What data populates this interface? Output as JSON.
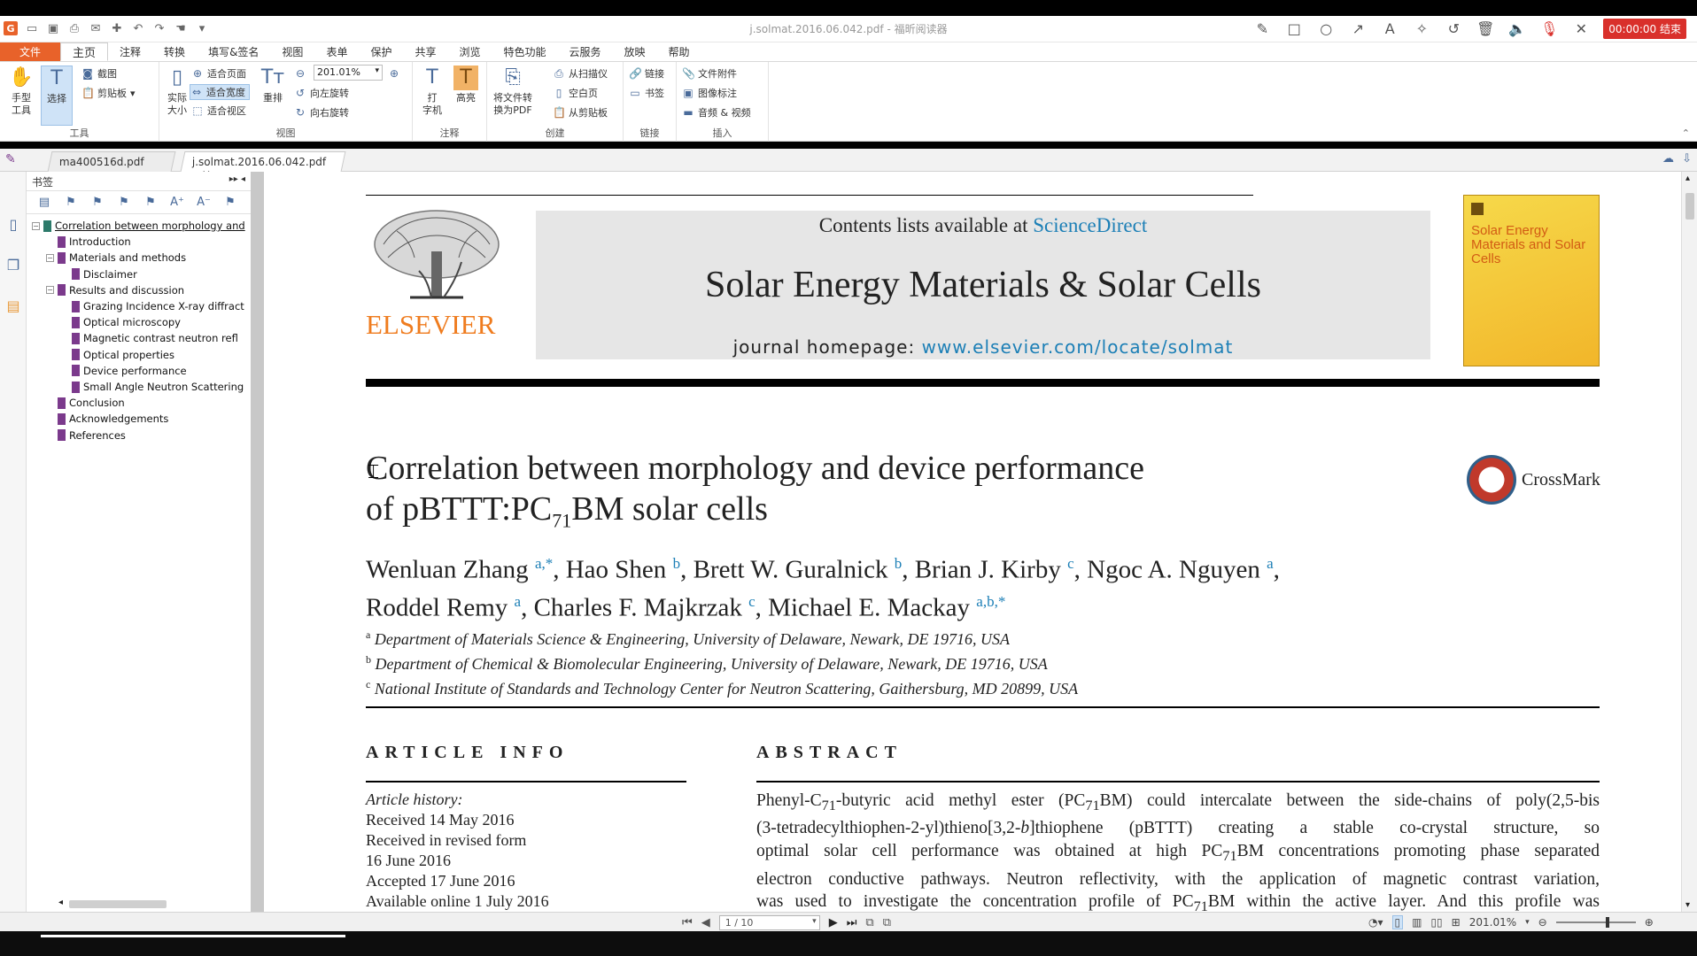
{
  "window": {
    "title": "j.solmat.2016.06.042.pdf - 福昕阅读器",
    "record_label": "00:00:00 结束"
  },
  "menu": {
    "items": [
      "文件",
      "主页",
      "注释",
      "转换",
      "填写&签名",
      "视图",
      "表单",
      "保护",
      "共享",
      "浏览",
      "特色功能",
      "云服务",
      "放映",
      "帮助"
    ],
    "active": "主页"
  },
  "ribbon": {
    "tools": {
      "hand": "手型\n工具",
      "select": "选择",
      "screenshot": "截图",
      "clipboard": "剪贴板",
      "label": "工具"
    },
    "view": {
      "actual_size": "实际\n大小",
      "fit_page": "适合页面",
      "fit_width": "适合宽度",
      "fit_visible": "适合视区",
      "reflow": "重排",
      "zoom_value": "201.01%",
      "rotate_left": "向左旋转",
      "rotate_right": "向右旋转",
      "label": "视图"
    },
    "comment": {
      "typewriter": "打\n字机",
      "highlight": "高亮",
      "label": "注释"
    },
    "create": {
      "convert": "将文件转\n换为PDF",
      "from_scanner": "从扫描仪",
      "blank": "空白页",
      "from_clipboard": "从剪贴板",
      "label": "创建"
    },
    "link": {
      "link": "链接",
      "bookmark": "书签",
      "label": "链接"
    },
    "insert": {
      "attachment": "文件附件",
      "image_annot": "图像标注",
      "audio_video": "音频 & 视频",
      "label": "插入"
    }
  },
  "tabs": [
    {
      "label": "ma400516d.pdf",
      "active": false
    },
    {
      "label": "j.solmat.2016.06.042.pdf",
      "active": true
    }
  ],
  "bookmarks": {
    "panel_title": "书签",
    "items": [
      {
        "label": "Correlation between morphology and",
        "level": 0,
        "toggle": "−"
      },
      {
        "label": "Introduction",
        "level": 1,
        "toggle": ""
      },
      {
        "label": "Materials and methods",
        "level": 1,
        "toggle": "−"
      },
      {
        "label": "Disclaimer",
        "level": 2,
        "toggle": ""
      },
      {
        "label": "Results and discussion",
        "level": 1,
        "toggle": "−"
      },
      {
        "label": "Grazing Incidence X-ray diffract",
        "level": 2,
        "toggle": ""
      },
      {
        "label": "Optical microscopy",
        "level": 2,
        "toggle": ""
      },
      {
        "label": "Magnetic contrast neutron refl",
        "level": 2,
        "toggle": ""
      },
      {
        "label": "Optical properties",
        "level": 2,
        "toggle": ""
      },
      {
        "label": "Device performance",
        "level": 2,
        "toggle": ""
      },
      {
        "label": "Small Angle Neutron Scattering",
        "level": 2,
        "toggle": ""
      },
      {
        "label": "Conclusion",
        "level": 1,
        "toggle": ""
      },
      {
        "label": "Acknowledgements",
        "level": 1,
        "toggle": ""
      },
      {
        "label": "References",
        "level": 1,
        "toggle": ""
      }
    ]
  },
  "document": {
    "contents_prefix": "Contents lists available at ",
    "sciencedirect": "ScienceDirect",
    "journal_name": "Solar Energy Materials & Solar Cells",
    "homepage_prefix": "journal homepage: ",
    "homepage_url": "www.elsevier.com/locate/solmat",
    "publisher": "ELSEVIER",
    "cover_title": "Solar Energy Materials and Solar Cells",
    "crossmark": "CrossMark",
    "title_line1": "Correlation between morphology and device performance",
    "title_line2_a": "of pBTTT:PC",
    "title_line2_sub": "71",
    "title_line2_b": "BM solar cells",
    "authors_line1": [
      {
        "name": "Wenluan Zhang",
        "sup": "a,*"
      },
      {
        "name": "Hao Shen",
        "sup": "b"
      },
      {
        "name": "Brett W. Guralnick",
        "sup": "b"
      },
      {
        "name": "Brian J. Kirby",
        "sup": "c"
      },
      {
        "name": "Ngoc A. Nguyen",
        "sup": "a"
      }
    ],
    "authors_line2": [
      {
        "name": "Roddel Remy",
        "sup": "a"
      },
      {
        "name": "Charles F. Majkrzak",
        "sup": "c"
      },
      {
        "name": "Michael E. Mackay",
        "sup": "a,b,*"
      }
    ],
    "affiliations": [
      {
        "sup": "a",
        "text": "Department of Materials Science & Engineering, University of Delaware, Newark, DE 19716, USA"
      },
      {
        "sup": "b",
        "text": "Department of Chemical & Biomolecular Engineering, University of Delaware, Newark, DE 19716, USA"
      },
      {
        "sup": "c",
        "text": "National Institute of Standards and Technology Center for Neutron Scattering, Gaithersburg, MD 20899, USA"
      }
    ],
    "article_info_head": "ARTICLE INFO",
    "abstract_head": "ABSTRACT",
    "history_head": "Article history:",
    "history": [
      "Received 14 May 2016",
      "Received in revised form",
      "16 June 2016",
      "Accepted 17 June 2016",
      "Available online 1 July 2016"
    ],
    "abstract_lines": [
      "Phenyl-C<sub>71</sub>-butyric acid methyl ester (PC<sub>71</sub>BM) could intercalate between the side-chains of poly(2,5-bis",
      "(3-tetradecylthiophen-2-yl)thieno[3,2-<i>b</i>]thiophene (pBTTT) creating a stable co-crystal structure, so",
      "optimal solar cell performance was obtained at high PC<sub>71</sub>BM concentrations promoting phase separated",
      "electron conductive pathways. Neutron reflectivity, with the application of magnetic contrast variation,",
      "was used to investigate the concentration profile of PC<sub>71</sub>BM within the active layer. And this profile was"
    ]
  },
  "statusbar": {
    "page_indicator": "1 / 10",
    "zoom": "201.01%"
  }
}
